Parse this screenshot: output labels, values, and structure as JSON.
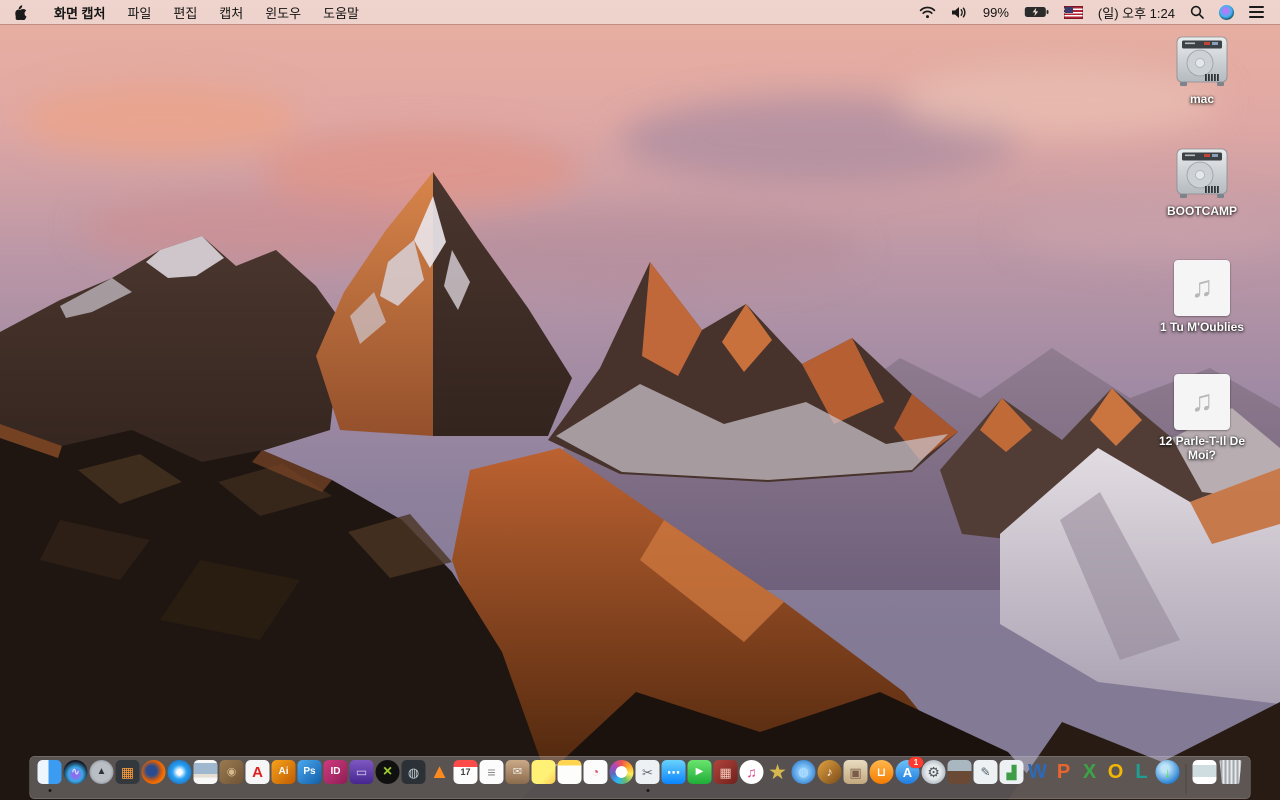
{
  "colors": {
    "menubar_bg": "rgba(238,216,210,0.88)",
    "dock_bg": "rgba(185,185,190,0.38)",
    "badge_red": "#ff3b30",
    "desktop_label": "#ffffff"
  },
  "menu_bar": {
    "apple_icon": "apple-logo-icon",
    "app_name": "화면 캡처",
    "menus": [
      {
        "key": "file",
        "label": "파일"
      },
      {
        "key": "edit",
        "label": "편집"
      },
      {
        "key": "capture",
        "label": "캡처"
      },
      {
        "key": "window",
        "label": "윈도우"
      },
      {
        "key": "help",
        "label": "도움말"
      }
    ],
    "status": {
      "icons": [
        "wifi-icon",
        "volume-icon",
        "battery-charging-icon",
        "input-source-us-flag",
        "spotlight-search-icon",
        "siri-icon",
        "notification-center-icon"
      ],
      "battery_percent": "99%",
      "clock": "(일) 오후 1:24"
    }
  },
  "desktop": {
    "icons": [
      {
        "name": "mac-drive",
        "type": "drive",
        "label": "mac"
      },
      {
        "name": "bootcamp-drive",
        "type": "drive",
        "label": "BOOTCAMP"
      },
      {
        "name": "audio-file-1",
        "type": "audio",
        "label": "1 Tu M'Oublies",
        "glyph": "♫"
      },
      {
        "name": "audio-file-2",
        "type": "audio",
        "label": "12 Parle-T-Il De Moi?",
        "glyph": "♫"
      }
    ]
  },
  "dock": {
    "apps": [
      {
        "name": "finder",
        "shape": "sq",
        "bg": "linear-gradient(90deg,#eef6fd 0 46%,#3b9cf2 46% 100%)",
        "glyph": "",
        "fg": "",
        "running": true
      },
      {
        "name": "siri",
        "shape": "ci",
        "bg": "radial-gradient(circle at 50% 60%,#8e6cf0 0 16%,#39a8e8 38%,#12121c 72%)",
        "glyph": "∿",
        "fg": "#cfe6ff",
        "fs": 11
      },
      {
        "name": "launchpad",
        "shape": "ci",
        "bg": "radial-gradient(circle,#b9bec4 0 55%,#63686e 100%)",
        "glyph": "▲",
        "fg": "#2f3337",
        "fs": 10
      },
      {
        "name": "mission-control",
        "shape": "sq",
        "bg": "#33383d",
        "glyph": "▦",
        "fg": "#ff9e3d",
        "fs": 14
      },
      {
        "name": "firefox",
        "shape": "ci",
        "bg": "radial-gradient(circle at 42% 45%,#2a4b8f 0 26%,#e66000 55%,#ffa726 100%)",
        "glyph": "",
        "fg": ""
      },
      {
        "name": "safari",
        "shape": "ci",
        "bg": "radial-gradient(circle,#eaf6ff 0 16%,#2aa0f2 42%,#1258a8 100%)",
        "glyph": "◈",
        "fg": "#ffffff",
        "fs": 9
      },
      {
        "name": "preview",
        "shape": "sq",
        "bg": "linear-gradient(180deg,#f7f7f7 0 12%,#9fb8d0 12% 58%,#e5ddcf 58% 72%,#f7f7f7 72% 100%)",
        "glyph": "",
        "fg": ""
      },
      {
        "name": "address-book-organizer",
        "shape": "sq",
        "bg": "linear-gradient(135deg,#9a7a52,#6e5334)",
        "glyph": "◉",
        "fg": "#d7b98c",
        "fs": 11
      },
      {
        "name": "adobe-acrobat-reader",
        "shape": "sq",
        "bg": "#f6f6f6",
        "glyph": "A",
        "fg": "#e02020",
        "fs": 15
      },
      {
        "name": "adobe-illustrator",
        "shape": "sq",
        "bg": "linear-gradient(135deg,#f6a21d,#c05c00)",
        "glyph": "Ai",
        "fg": "#ffffff",
        "fs": 10
      },
      {
        "name": "adobe-photoshop",
        "shape": "sq",
        "bg": "linear-gradient(135deg,#4aa8f0,#115fa8)",
        "glyph": "Ps",
        "fg": "#ffffff",
        "fs": 10
      },
      {
        "name": "adobe-indesign",
        "shape": "sq",
        "bg": "linear-gradient(135deg,#cf3a7e,#8e1e55)",
        "glyph": "ID",
        "fg": "#ffffff",
        "fs": 10
      },
      {
        "name": "toast-titanium",
        "shape": "sq",
        "bg": "linear-gradient(180deg,#7e57c2,#45278f)",
        "glyph": "▭",
        "fg": "#d9cdf0",
        "fs": 12
      },
      {
        "name": "dvd-ripper-x",
        "shape": "ci",
        "bg": "#101010",
        "glyph": "×",
        "fg": "#9ccc2e",
        "fs": 16
      },
      {
        "name": "media-disc-app",
        "shape": "sq",
        "bg": "#2b3136",
        "glyph": "◍",
        "fg": "#c4ced4",
        "fs": 13
      },
      {
        "name": "vlc",
        "shape": "none",
        "bg": "transparent",
        "glyph": "▲",
        "fg": "#ff8a1e",
        "fs": 20
      },
      {
        "name": "calendar",
        "shape": "sq",
        "bg": "linear-gradient(180deg,#ff4a4a 0 30%,#fdfdfd 30% 100%)",
        "glyph": "17",
        "fg": "#3c3c3c",
        "fs": 9
      },
      {
        "name": "reminders",
        "shape": "sq",
        "bg": "#fcfcfc",
        "glyph": "≡",
        "fg": "#8a8a8a",
        "fs": 14
      },
      {
        "name": "unarchiver",
        "shape": "sq",
        "bg": "linear-gradient(180deg,#caa987,#8a6b4c)",
        "glyph": "✉",
        "fg": "#f2ede6",
        "fs": 11
      },
      {
        "name": "stickies",
        "shape": "sq",
        "bg": "linear-gradient(135deg,#fff176 0 65%,#f9c74f 100%)",
        "glyph": "",
        "fg": ""
      },
      {
        "name": "notes",
        "shape": "sq",
        "bg": "linear-gradient(180deg,#ffd54f 0 22%,#fdfdfb 22% 100%)",
        "glyph": "",
        "fg": ""
      },
      {
        "name": "colorsync-document",
        "shape": "sq",
        "bg": "#fcfcfc",
        "glyph": "◔",
        "fg": "#d0485f",
        "fs": 12
      },
      {
        "name": "photos",
        "shape": "ci",
        "bg": "radial-gradient(circle,#ffffff 0 34%,rgba(255,255,255,0) 35%),conic-gradient(#ef5350,#ffa726,#ffee58,#66bb6a,#29b6f6,#5c6bc0,#ab47bc,#ef5350)",
        "glyph": "",
        "fg": ""
      },
      {
        "name": "grab-screen-capture",
        "shape": "sq",
        "bg": "#eef1f3",
        "glyph": "✂",
        "fg": "#5c6870",
        "fs": 13,
        "running": true
      },
      {
        "name": "messages",
        "shape": "sq",
        "bg": "linear-gradient(180deg,#69d2fb,#0a84ff)",
        "glyph": "⋯",
        "fg": "#ffffff",
        "fs": 13
      },
      {
        "name": "facetime",
        "shape": "sq",
        "bg": "linear-gradient(180deg,#6ae46e,#1fad38)",
        "glyph": "▶",
        "fg": "#ffffff",
        "fs": 10
      },
      {
        "name": "photo-booth",
        "shape": "sq",
        "bg": "linear-gradient(135deg,#b0443c,#70201c)",
        "glyph": "▦",
        "fg": "#f3c8b8",
        "fs": 13
      },
      {
        "name": "itunes",
        "shape": "ci",
        "bg": "#ffffff",
        "glyph": "♫",
        "fg": "#e0418f",
        "fs": 14
      },
      {
        "name": "imovie",
        "shape": "none",
        "bg": "transparent",
        "glyph": "★",
        "fg": "#d7b84e",
        "fs": 21
      },
      {
        "name": "dvd-player-disc",
        "shape": "ci",
        "bg": "radial-gradient(circle,#8fd0ff 0 22%,#1565c0 100%)",
        "glyph": "◍",
        "fg": "#bbdefb",
        "fs": 12
      },
      {
        "name": "garageband",
        "shape": "ci",
        "bg": "linear-gradient(135deg,#e0a23f,#7a4a1a)",
        "glyph": "♪",
        "fg": "#fff8ee",
        "fs": 12
      },
      {
        "name": "scrapbook-collage-app",
        "shape": "sq",
        "bg": "linear-gradient(180deg,#e8dcc0,#c3a87f)",
        "glyph": "▣",
        "fg": "#7c5c48",
        "fs": 13
      },
      {
        "name": "ibooks",
        "shape": "ci",
        "bg": "linear-gradient(180deg,#ffb74d,#f57c00)",
        "glyph": "⊔",
        "fg": "#ffffff",
        "fs": 12
      },
      {
        "name": "app-store",
        "shape": "ci",
        "bg": "linear-gradient(180deg,#6fc2f7,#1f7de0)",
        "glyph": "A",
        "fg": "#ffffff",
        "fs": 13,
        "badge": "1"
      },
      {
        "name": "system-preferences",
        "shape": "ci",
        "bg": "radial-gradient(circle,#e6eaec 0 40%,#8d9aa4 100%)",
        "glyph": "⚙",
        "fg": "#4c565e",
        "fs": 14
      },
      {
        "name": "keynote-09",
        "shape": "sq",
        "bg": "linear-gradient(180deg,#a9b7c0 0 45%,#6b4a35 45% 100%)",
        "glyph": "",
        "fg": ""
      },
      {
        "name": "pages-09",
        "shape": "sq",
        "bg": "#eef1f3",
        "glyph": "✎",
        "fg": "#51606b",
        "fs": 12
      },
      {
        "name": "numbers-09",
        "shape": "sq",
        "bg": "#eef1f3",
        "glyph": "▟",
        "fg": "#3d9e46",
        "fs": 13
      },
      {
        "name": "microsoft-word",
        "shape": "none",
        "bg": "transparent",
        "glyph": "W",
        "fg": "#2b6ab8",
        "fs": 20
      },
      {
        "name": "microsoft-powerpoint",
        "shape": "none",
        "bg": "transparent",
        "glyph": "P",
        "fg": "#e8652e",
        "fs": 20
      },
      {
        "name": "microsoft-excel",
        "shape": "none",
        "bg": "transparent",
        "glyph": "X",
        "fg": "#3aa546",
        "fs": 20
      },
      {
        "name": "microsoft-outlook",
        "shape": "none",
        "bg": "transparent",
        "glyph": "O",
        "fg": "#f2b705",
        "fs": 20
      },
      {
        "name": "microsoft-lync",
        "shape": "none",
        "bg": "transparent",
        "glyph": "L",
        "fg": "#1f9e94",
        "fs": 20
      },
      {
        "name": "web-downloader",
        "shape": "ci",
        "bg": "radial-gradient(circle at 40% 35%,#bde4f7 0 18%,#2f86d6 70%,#1a5aa0 100%)",
        "glyph": "↓",
        "fg": "#5fe04a",
        "fs": 13
      },
      {
        "name": "dock-divider",
        "divider": true
      },
      {
        "name": "document-file",
        "shape": "sq",
        "bg": "linear-gradient(180deg,#ffffff 0 20%,#cfdde0 20% 70%,#ffffff 70% 100%)",
        "glyph": "",
        "fg": ""
      },
      {
        "name": "trash-full",
        "shape": "trash",
        "bg": "repeating-linear-gradient(90deg,rgba(238,241,243,0.95) 0 2px,rgba(168,176,182,0.9) 2px 4px)",
        "glyph": "",
        "fg": ""
      }
    ]
  }
}
